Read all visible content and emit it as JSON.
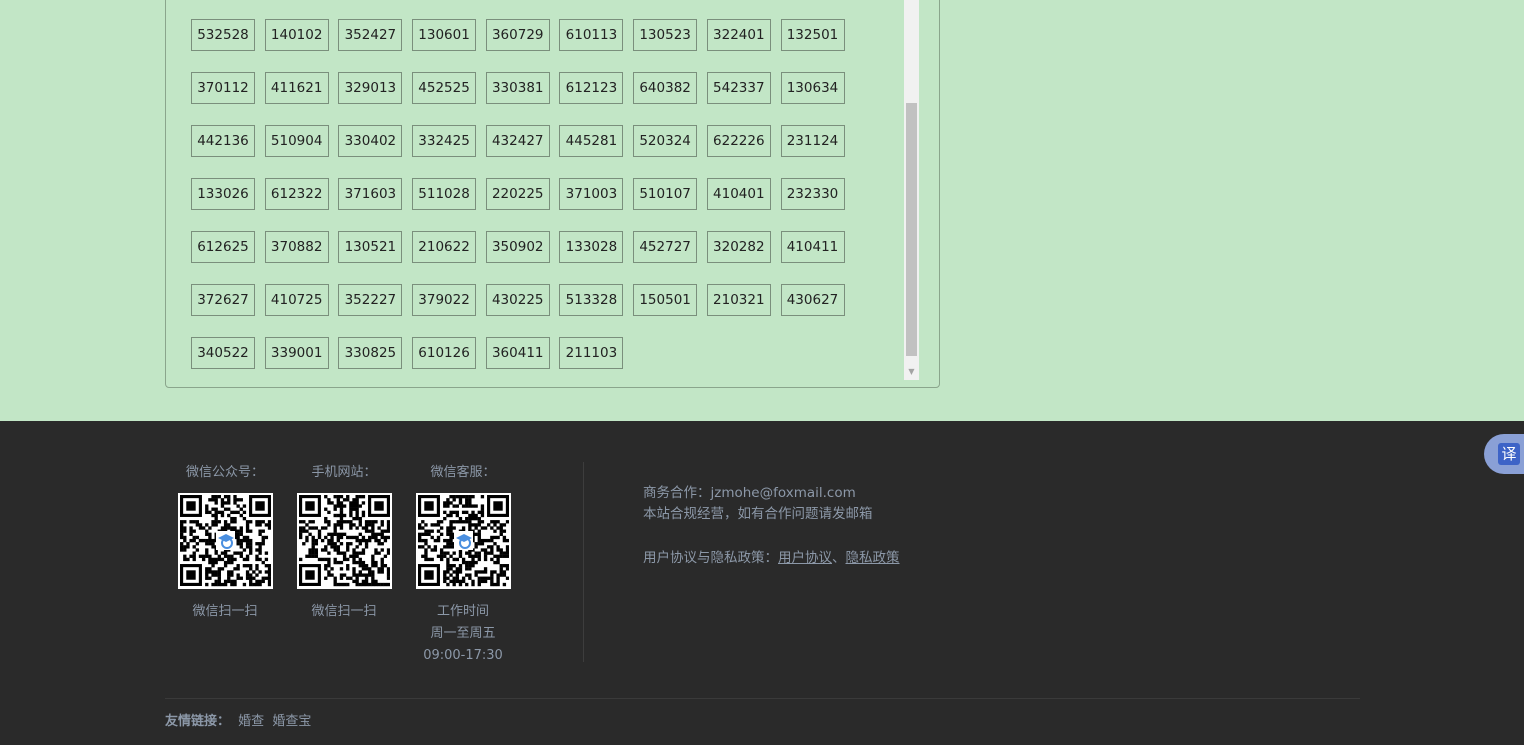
{
  "codes": [
    [
      "532528",
      "140102",
      "352427",
      "130601",
      "360729",
      "610113",
      "130523",
      "322401",
      "132501"
    ],
    [
      "370112",
      "411621",
      "329013",
      "452525",
      "330381",
      "612123",
      "640382",
      "542337",
      "130634"
    ],
    [
      "442136",
      "510904",
      "330402",
      "332425",
      "432427",
      "445281",
      "520324",
      "622226",
      "231124"
    ],
    [
      "133026",
      "612322",
      "371603",
      "511028",
      "220225",
      "371003",
      "510107",
      "410401",
      "232330"
    ],
    [
      "612625",
      "370882",
      "130521",
      "210622",
      "350902",
      "133028",
      "452727",
      "320282",
      "410411"
    ],
    [
      "372627",
      "410725",
      "352227",
      "379022",
      "430225",
      "513328",
      "150501",
      "210321",
      "430627"
    ],
    [
      "340522",
      "339001",
      "330825",
      "610126",
      "360411",
      "211103"
    ]
  ],
  "footer": {
    "qr": [
      {
        "title": "微信公众号：",
        "caption": [
          "微信扫一扫"
        ]
      },
      {
        "title": "手机网站：",
        "caption": [
          "微信扫一扫"
        ]
      },
      {
        "title": "微信客服：",
        "caption": [
          "工作时间",
          "周一至周五",
          "09:00-17:30"
        ]
      }
    ],
    "contact": {
      "business": "商务合作：jzmohe@foxmail.com",
      "compliance": "本站合规经营，如有合作问题请发邮箱",
      "policy_prefix": "用户协议与隐私政策：",
      "policy_link1": "用户协议",
      "policy_sep": "、",
      "policy_link2": "隐私政策"
    },
    "friend_links": {
      "label": "友情链接：",
      "items": [
        "婚查",
        "婚查宝"
      ]
    }
  },
  "translate": {
    "label": "译"
  },
  "colors": {
    "background": "#c2e6c6",
    "footer": "#2a2a2a",
    "footer_text": "#8c98a8",
    "accent": "#3d63c7"
  }
}
